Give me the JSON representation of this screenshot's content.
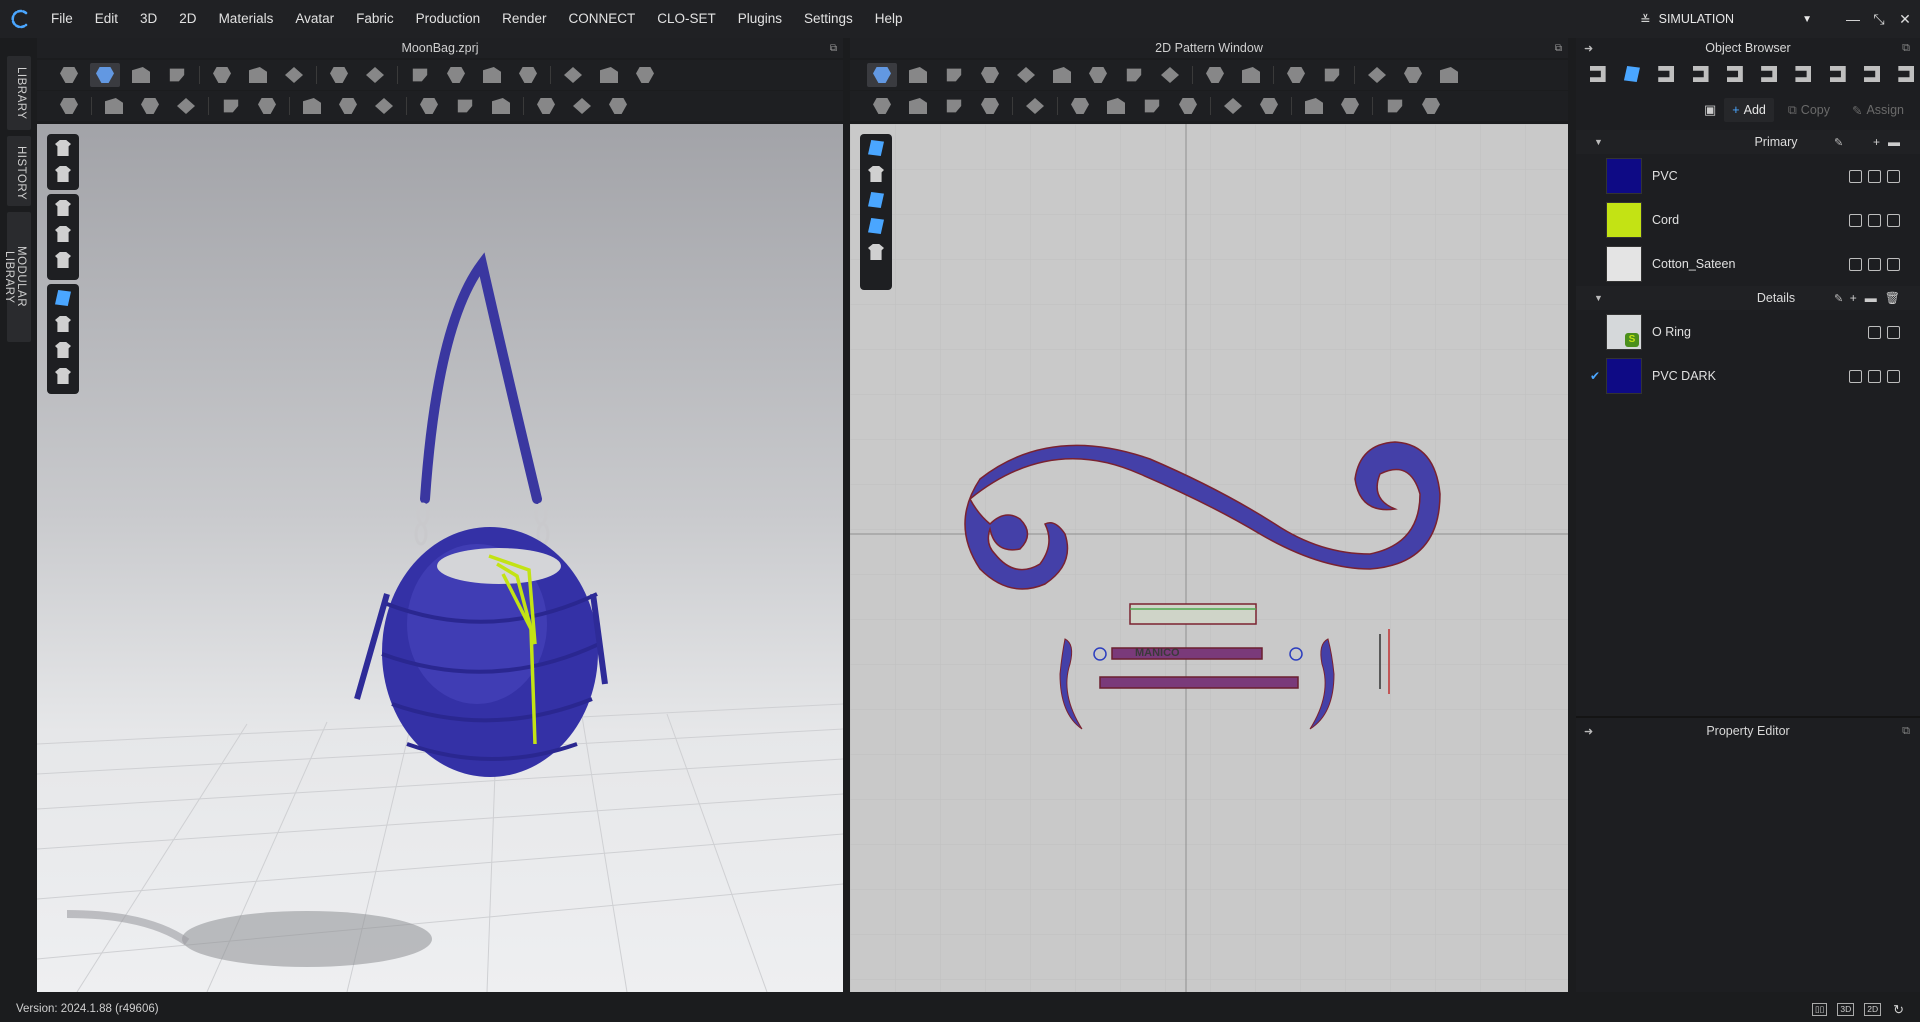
{
  "menu": [
    "File",
    "Edit",
    "3D",
    "2D",
    "Materials",
    "Avatar",
    "Fabric",
    "Production",
    "Render",
    "CONNECT",
    "CLO-SET",
    "Plugins",
    "Settings",
    "Help"
  ],
  "mode": {
    "label": "SIMULATION"
  },
  "left_tabs": [
    "LIBRARY",
    "HISTORY",
    "MODULAR LIBRARY"
  ],
  "view3d": {
    "title": "MoonBag.zprj"
  },
  "view2d": {
    "title": "2D Pattern Window",
    "pattern_label": "MANICO"
  },
  "object_browser": {
    "title": "Object Browser",
    "actions": {
      "add": "Add",
      "copy": "Copy",
      "assign": "Assign"
    },
    "groups": [
      {
        "name": "Primary",
        "fabrics": [
          {
            "name": "PVC",
            "color": "#0e0a85",
            "checked": false
          },
          {
            "name": "Cord",
            "color": "#c3e314",
            "checked": false
          },
          {
            "name": "Cotton_Sateen",
            "color": "#e4e4e4",
            "checked": false
          }
        ]
      },
      {
        "name": "Details",
        "fabrics": [
          {
            "name": "O Ring",
            "color": "#d5d8da",
            "checked": false
          },
          {
            "name": "PVC DARK",
            "color": "#0e0a85",
            "checked": true
          }
        ]
      }
    ]
  },
  "property_editor": {
    "title": "Property Editor"
  },
  "status": {
    "version": "Version: 2024.1.88 (r49606)",
    "view_modes": [
      "3D",
      "2D"
    ]
  },
  "colors": {
    "accent": "#4aa6ff",
    "fabric_blue": "#3f3aa8",
    "cord_green": "#c3e314"
  }
}
